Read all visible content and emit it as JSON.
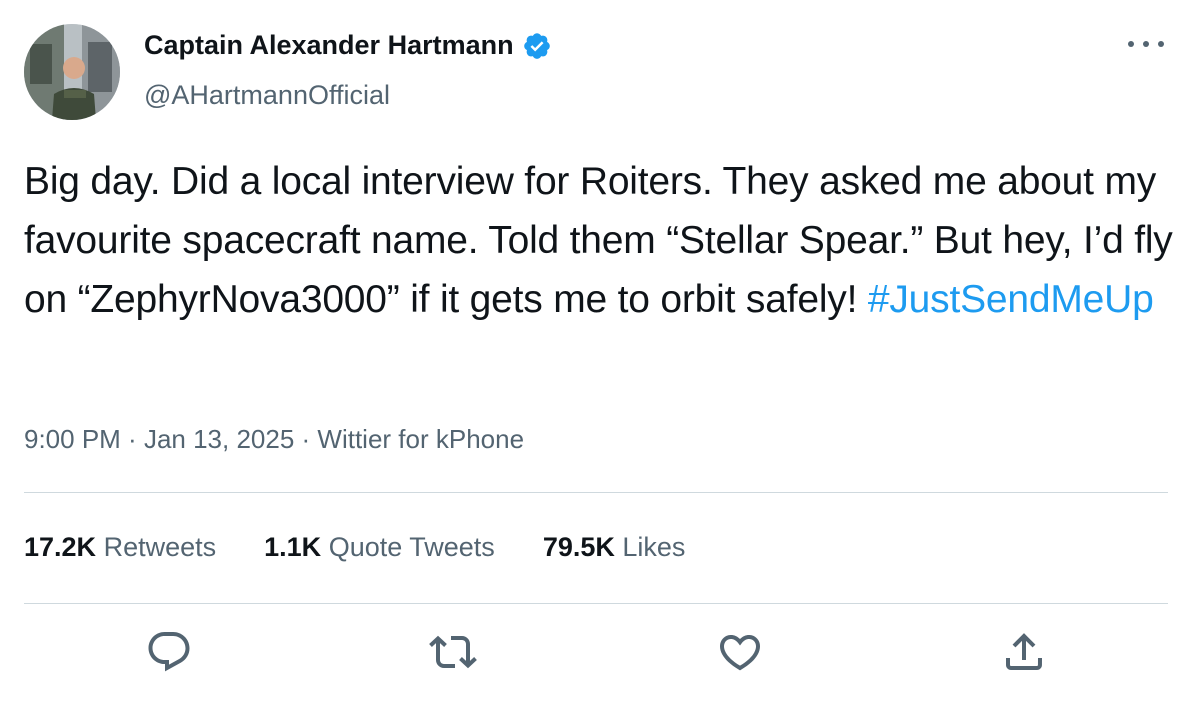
{
  "author": {
    "name": "Captain Alexander Hartmann",
    "handle": "@AHartmannOfficial",
    "verified_icon": "verified-badge-icon",
    "verified_color": "#1d9bf0"
  },
  "tweet": {
    "text": "Big day. Did a local interview for Roiters. They asked me about my favourite spacecraft name. Told them “Stellar Spear.” But hey, I’d fly on “ZephyrNova3000” if it gets me to orbit safely! ",
    "hashtag": "#JustSendMeUp"
  },
  "meta": {
    "time": "9:00 PM",
    "separator": " · ",
    "date": "Jan 13, 2025",
    "source": "Wittier for kPhone"
  },
  "stats": {
    "retweets_count": "17.2K",
    "retweets_label": "Retweets",
    "quotes_count": "1.1K",
    "quotes_label": "Quote Tweets",
    "likes_count": "79.5K",
    "likes_label": "Likes"
  },
  "actions": [
    {
      "icon": "reply-icon"
    },
    {
      "icon": "retweet-icon"
    },
    {
      "icon": "like-icon"
    },
    {
      "icon": "share-icon"
    }
  ],
  "colors": {
    "text": "#0f1419",
    "secondary": "#536471",
    "accent": "#1d9bf0",
    "divider": "#cfd9de"
  }
}
